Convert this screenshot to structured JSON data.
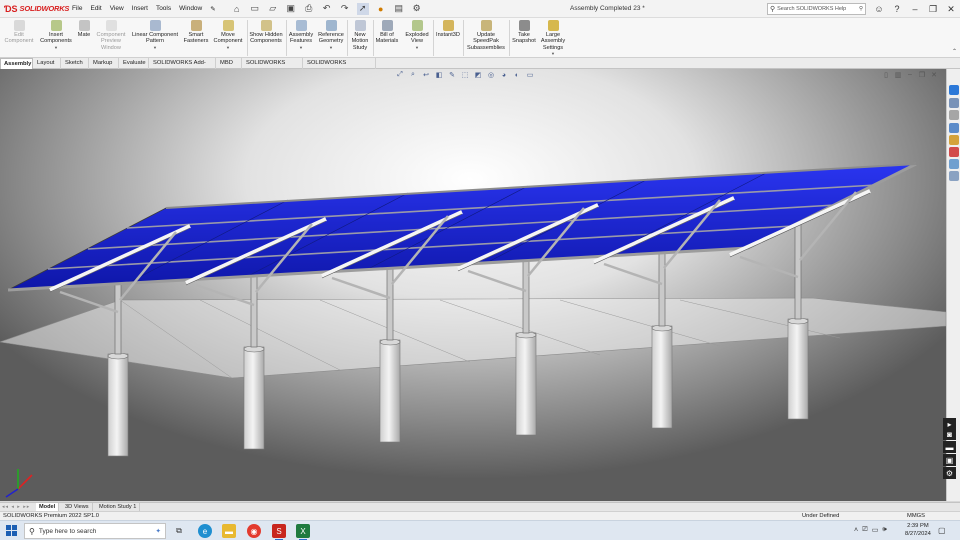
{
  "app": {
    "brand": "SOLIDWORKS",
    "document_title": "Assembly Completed 23 *"
  },
  "menu": [
    "File",
    "Edit",
    "View",
    "Insert",
    "Tools",
    "Window"
  ],
  "search": {
    "placeholder": "Search SOLIDWORKS Help"
  },
  "commands": [
    {
      "label": "Edit Component",
      "disabled": true
    },
    {
      "label": "Insert Components",
      "disabled": false
    },
    {
      "label": "Mate",
      "disabled": false
    },
    {
      "label": "Component Preview Window",
      "disabled": true
    },
    {
      "label": "Linear Component Pattern",
      "disabled": false
    },
    {
      "label": "Smart Fasteners",
      "disabled": false
    },
    {
      "label": "Move Component",
      "disabled": false
    },
    {
      "label": "Show Hidden Components",
      "disabled": false
    },
    {
      "label": "Assembly Features",
      "disabled": false
    },
    {
      "label": "Reference Geometry",
      "disabled": false
    },
    {
      "label": "New Motion Study",
      "disabled": false
    },
    {
      "label": "Bill of Materials",
      "disabled": false
    },
    {
      "label": "Exploded View",
      "disabled": false
    },
    {
      "label": "Instant3D",
      "disabled": false
    },
    {
      "label": "Update SpeedPak Subassemblies",
      "disabled": false
    },
    {
      "label": "Take Snapshot",
      "disabled": false
    },
    {
      "label": "Large Assembly Settings",
      "disabled": false
    }
  ],
  "tabs": [
    "Assembly",
    "Layout",
    "Sketch",
    "Markup",
    "Evaluate",
    "SOLIDWORKS Add-Ins",
    "MBD",
    "SOLIDWORKS CAM",
    "SOLIDWORKS Inspection"
  ],
  "active_tab": "Assembly",
  "bottom_tabs": [
    "Model",
    "3D Views",
    "Motion Study 1"
  ],
  "active_bottom_tab": "Model",
  "status": {
    "product": "SOLIDWORKS Premium 2022 SP1.0",
    "definition": "Under Defined",
    "units": "MMGS"
  },
  "taskbar": {
    "search_placeholder": "Type here to search",
    "time": "2:39 PM",
    "date": "8/27/2024"
  },
  "colors": {
    "panel_blue": "#1a22d8",
    "brand_red": "#d81e1e",
    "frame_gray": "#9a9a9a"
  }
}
